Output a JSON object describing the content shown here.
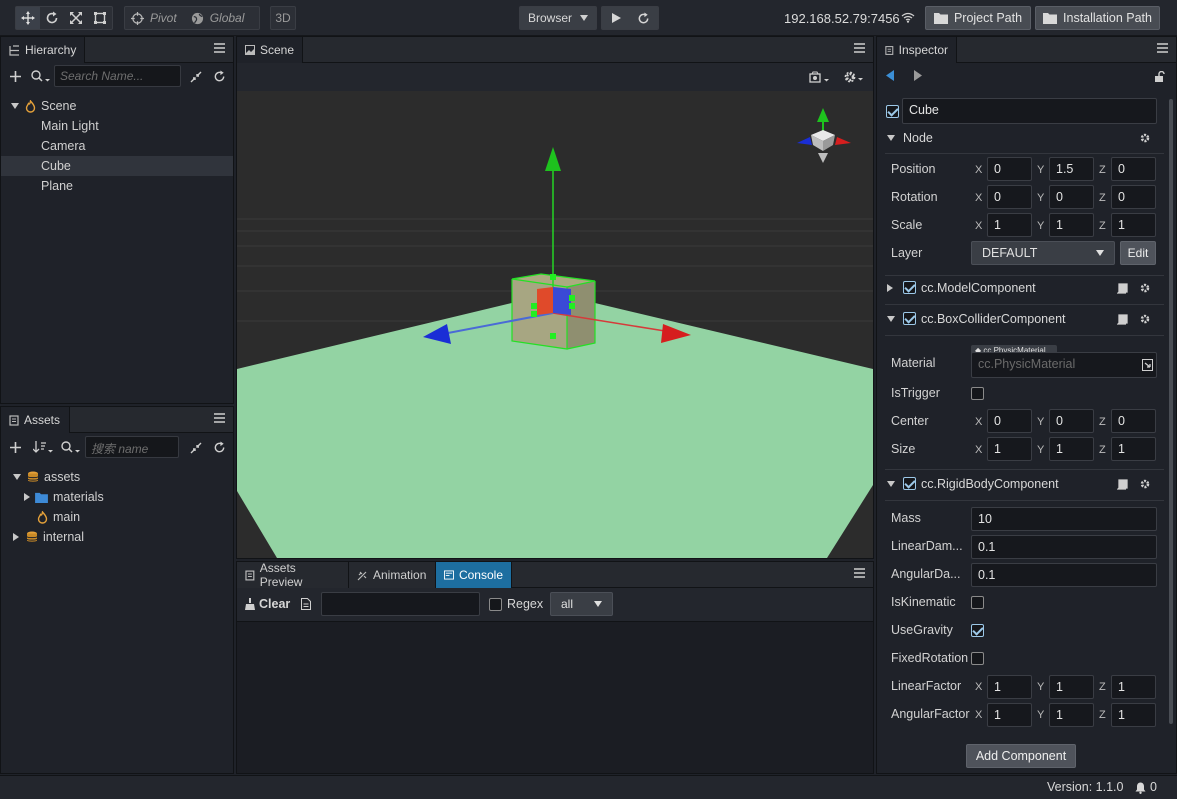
{
  "toolbar": {
    "pivot": "Pivot",
    "global": "Global",
    "mode3d": "3D",
    "browser": "Browser",
    "ip": "192.168.52.79:7456",
    "project_path": "Project Path",
    "install_path": "Installation Path"
  },
  "hierarchy": {
    "title": "Hierarchy",
    "search_placeholder": "Search Name...",
    "root": "Scene",
    "items": [
      "Main Light",
      "Camera",
      "Cube",
      "Plane"
    ],
    "selected": "Cube"
  },
  "assets": {
    "title": "Assets",
    "search_placeholder": "搜索 name",
    "root": "assets",
    "items": [
      {
        "label": "materials",
        "kind": "folder"
      },
      {
        "label": "main",
        "kind": "scene"
      }
    ],
    "internal": "internal"
  },
  "scene": {
    "title": "Scene"
  },
  "console": {
    "tabs": [
      "Assets Preview",
      "Animation",
      "Console"
    ],
    "active_tab": "Console",
    "clear": "Clear",
    "regex": "Regex",
    "filter": "all"
  },
  "inspector": {
    "title": "Inspector",
    "name": "Cube",
    "node_section": "Node",
    "position": {
      "label": "Position",
      "x": "0",
      "y": "1.5",
      "z": "0"
    },
    "rotation": {
      "label": "Rotation",
      "x": "0",
      "y": "0",
      "z": "0"
    },
    "scale": {
      "label": "Scale",
      "x": "1",
      "y": "1",
      "z": "1"
    },
    "layer": {
      "label": "Layer",
      "value": "DEFAULT",
      "edit": "Edit"
    },
    "model_component": "cc.ModelComponent",
    "box_collider": {
      "title": "cc.BoxColliderComponent",
      "material_label": "Material",
      "material_tag": "cc.PhysicMaterial",
      "material_placeholder": "cc.PhysicMaterial",
      "is_trigger": "IsTrigger",
      "center": {
        "label": "Center",
        "x": "0",
        "y": "0",
        "z": "0"
      },
      "size": {
        "label": "Size",
        "x": "1",
        "y": "1",
        "z": "1"
      }
    },
    "rigid_body": {
      "title": "cc.RigidBodyComponent",
      "mass": {
        "label": "Mass",
        "value": "10"
      },
      "linear_damping": {
        "label": "LinearDam...",
        "value": "0.1"
      },
      "angular_damping": {
        "label": "AngularDa...",
        "value": "0.1"
      },
      "is_kinematic": "IsKinematic",
      "use_gravity": "UseGravity",
      "fixed_rotation": "FixedRotation",
      "linear_factor": {
        "label": "LinearFactor",
        "x": "1",
        "y": "1",
        "z": "1"
      },
      "angular_factor": {
        "label": "AngularFactor",
        "x": "1",
        "y": "1",
        "z": "1"
      }
    },
    "add_component": "Add Component"
  },
  "axis_labels": {
    "x": "X",
    "y": "Y",
    "z": "Z"
  },
  "status": {
    "version": "Version: 1.1.0",
    "notifications": "0"
  },
  "colors": {
    "accent": "#1d6ea0",
    "x_axis": "#d61e1e",
    "y_axis": "#1fc21f",
    "z_axis": "#1a2ed6",
    "ground": "#93d3a3"
  }
}
